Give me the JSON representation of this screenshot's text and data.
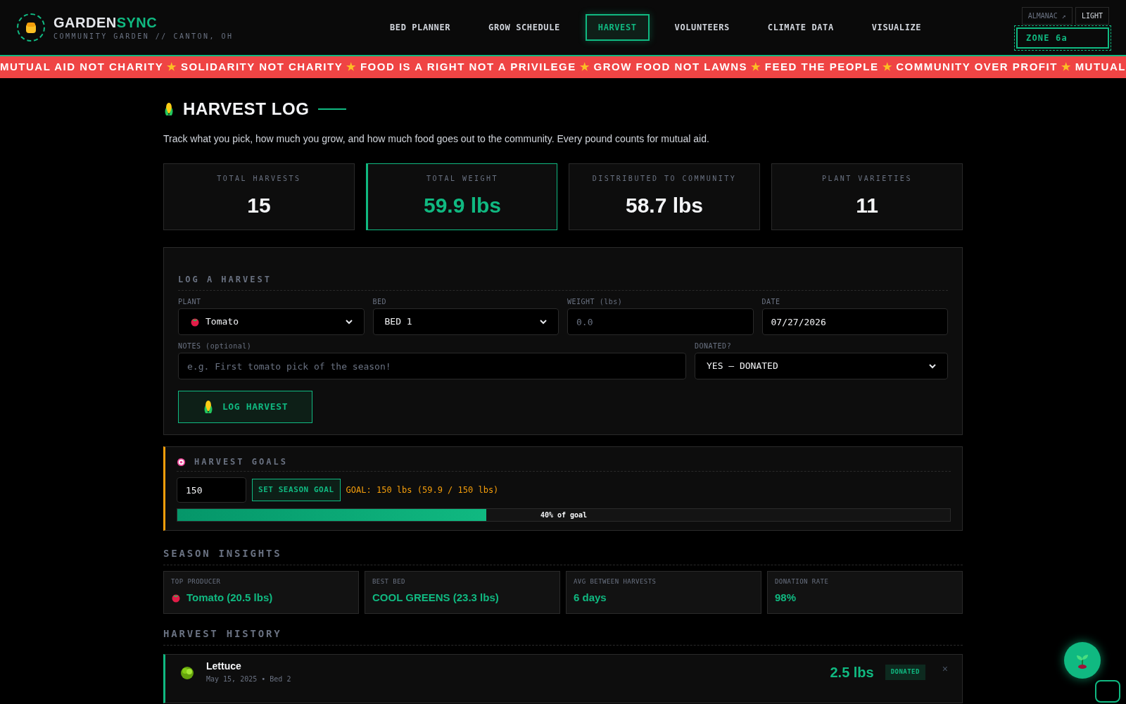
{
  "header": {
    "logo_first": "GARDEN",
    "logo_second": "SYNC",
    "subtitle": "COMMUNITY GARDEN // CANTON, OH",
    "almanac": "ALMANAC ↗",
    "theme": "LIGHT",
    "zone": "ZONE 6a"
  },
  "nav": [
    {
      "label": "BED PLANNER",
      "selected": false
    },
    {
      "label": "GROW SCHEDULE",
      "selected": false
    },
    {
      "label": "HARVEST",
      "selected": true
    },
    {
      "label": "VOLUNTEERS",
      "selected": false
    },
    {
      "label": "CLIMATE DATA",
      "selected": false
    },
    {
      "label": "VISUALIZE",
      "selected": false
    }
  ],
  "ticker": [
    "MUTUAL AID NOT CHARITY",
    "★",
    "SOLIDARITY NOT CHARITY",
    "★",
    "FOOD IS A RIGHT NOT A PRIVILEGE",
    "★",
    "GROW FOOD NOT LAWNS",
    "★",
    "FEED THE PEOPLE",
    "★",
    "COMMUNITY OVER PROFIT",
    "★",
    "MUTUAL"
  ],
  "page": {
    "title": "HARVEST LOG",
    "description": "Track what you pick, how much you grow, and how much food goes out to the community. Every pound counts for mutual aid."
  },
  "stats": [
    {
      "label": "TOTAL HARVESTS",
      "value": "15",
      "selected": false
    },
    {
      "label": "TOTAL WEIGHT",
      "value": "59.9 lbs",
      "selected": true
    },
    {
      "label": "DISTRIBUTED TO COMMUNITY",
      "value": "58.7 lbs",
      "selected": false
    },
    {
      "label": "PLANT VARIETIES",
      "value": "11",
      "selected": false
    }
  ],
  "form": {
    "title": "LOG A HARVEST",
    "plant": {
      "label": "PLANT",
      "value": "Tomato"
    },
    "bed": {
      "label": "BED",
      "value": "BED 1"
    },
    "weight": {
      "label": "WEIGHT (lbs)",
      "placeholder": "0.0"
    },
    "date": {
      "label": "DATE",
      "value": "07/27/2026"
    },
    "notes": {
      "label": "NOTES (optional)",
      "placeholder": "e.g. First tomato pick of the season!"
    },
    "donated": {
      "label": "DONATED?",
      "value": "YES — DONATED"
    },
    "submit": "LOG HARVEST"
  },
  "goals": {
    "title": "HARVEST GOALS",
    "input_value": "150",
    "button": "SET SEASON GOAL",
    "status": "GOAL: 150 lbs (59.9 / 150 lbs)",
    "level": 0.4,
    "progress_label": "40% of goal"
  },
  "insights": {
    "title": "SEASON INSIGHTS",
    "cards": [
      {
        "label": "TOP PRODUCER",
        "value": "Tomato (20.5 lbs)",
        "kind": "plant"
      },
      {
        "label": "BEST BED",
        "value": "COOL GREENS (23.3 lbs)",
        "kind": "stat"
      },
      {
        "label": "AVG BETWEEN HARVESTS",
        "value": "6 days",
        "kind": "stat"
      },
      {
        "label": "DONATION RATE",
        "value": "98%",
        "kind": "stat"
      }
    ]
  },
  "history": {
    "title": "HARVEST HISTORY",
    "entries": [
      {
        "plant": "Lettuce",
        "meta": "May 15, 2025 • Bed 2",
        "weight": "2.5 lbs",
        "donated": true,
        "status": "DONATED",
        "remove": "×"
      }
    ]
  }
}
